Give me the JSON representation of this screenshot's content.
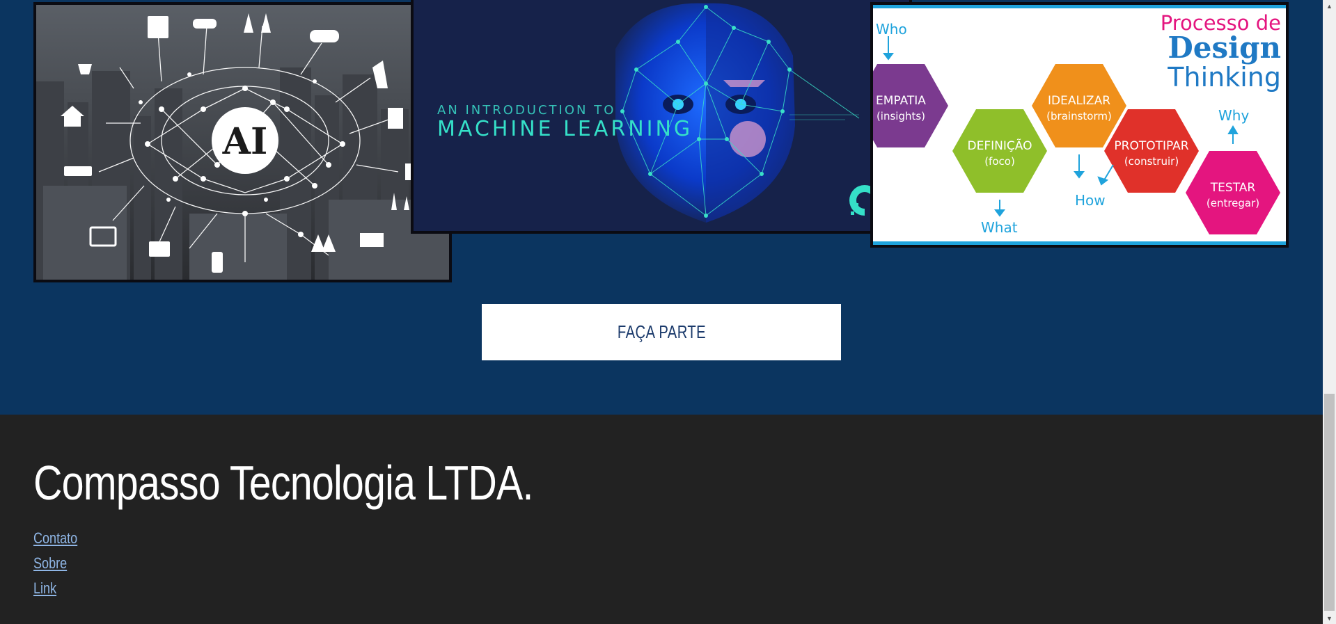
{
  "gallery": {
    "ai_image": {
      "alt": "AI brain network over city skyline",
      "badge": "AI"
    },
    "ml_image": {
      "alt": "An introduction to machine learning",
      "kicker": "AN INTRODUCTION TO",
      "title": "MACHINE LEARNING"
    },
    "dt_image": {
      "alt": "Processo de Design Thinking",
      "title_line1": "Processo de",
      "title_line2": "Design",
      "title_line3": "Thinking",
      "steps": [
        {
          "name": "EMPATIA",
          "sub": "(insights)",
          "color": "#7b3a8f"
        },
        {
          "name": "DEFINIÇÃO",
          "sub": "(foco)",
          "color": "#8fbf2a"
        },
        {
          "name": "IDEALIZAR",
          "sub": "(brainstorm)",
          "color": "#f0901b"
        },
        {
          "name": "PROTOTIPAR",
          "sub": "(construir)",
          "color": "#e0312a"
        },
        {
          "name": "TESTAR",
          "sub": "(entregar)",
          "color": "#e4157f"
        }
      ],
      "who": "Who",
      "what": "What",
      "how": "How",
      "why": "Why"
    }
  },
  "cta": {
    "label": "FAÇA PARTE"
  },
  "footer": {
    "company": "Compasso Tecnologia LTDA.",
    "links": [
      "Contato",
      "Sobre",
      "Link"
    ]
  },
  "colors": {
    "section_bg": "#0b3560",
    "footer_bg": "#222222",
    "link": "#8fb6e6",
    "cta_text": "#1b3a6b"
  }
}
